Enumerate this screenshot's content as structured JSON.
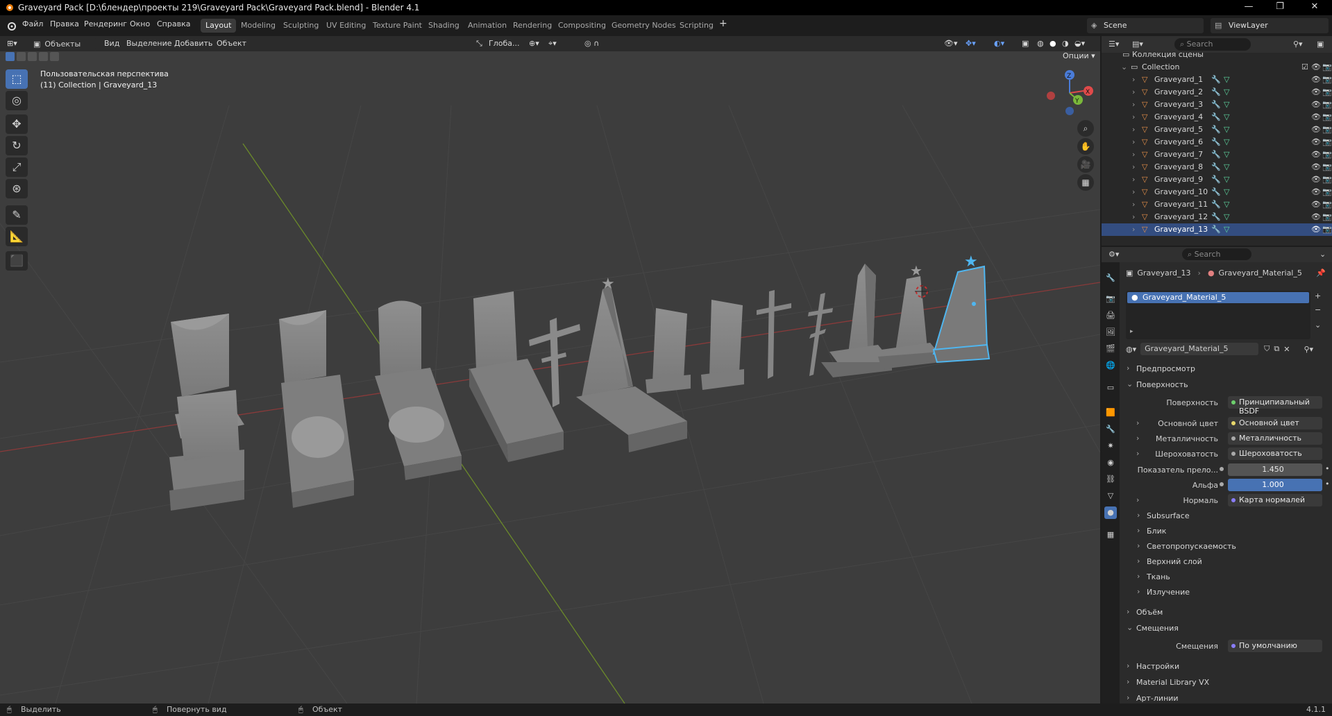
{
  "window": {
    "title": "Graveyard Pack [D:\\блендер\\проекты 219\\Graveyard Pack\\Graveyard Pack.blend] - Blender 4.1"
  },
  "menu": [
    "Файл",
    "Правка",
    "Рендеринг",
    "Окно",
    "Справка"
  ],
  "workspaces": [
    "Layout",
    "Modeling",
    "Sculpting",
    "UV Editing",
    "Texture Paint",
    "Shading",
    "Animation",
    "Rendering",
    "Compositing",
    "Geometry Nodes",
    "Scripting"
  ],
  "active_workspace": "Layout",
  "scene": {
    "scene_name": "Scene",
    "view_layer": "ViewLayer"
  },
  "viewport_header": {
    "mode": "Объекты",
    "menus": [
      "Вид",
      "Выделение",
      "Добавить",
      "Объект"
    ],
    "transform": "Глоба...",
    "options": "Опции"
  },
  "viewport_overlay": {
    "line1": "Пользовательская перспектива",
    "line2": "(11) Collection | Graveyard_13"
  },
  "outliner": {
    "search_placeholder": "Search",
    "scene_collection": "Коллекция сцены",
    "collection": "Collection",
    "items": [
      "Graveyard_1",
      "Graveyard_2",
      "Graveyard_3",
      "Graveyard_4",
      "Graveyard_5",
      "Graveyard_6",
      "Graveyard_7",
      "Graveyard_8",
      "Graveyard_9",
      "Graveyard_10",
      "Graveyard_11",
      "Graveyard_12",
      "Graveyard_13"
    ],
    "selected": "Graveyard_13"
  },
  "properties": {
    "search_placeholder": "Search",
    "breadcrumb_object": "Graveyard_13",
    "breadcrumb_material": "Graveyard_Material_5",
    "slot_material": "Graveyard_Material_5",
    "material_field": "Graveyard_Material_5",
    "sections": {
      "preview": "Предпросмотр",
      "surface": "Поверхность",
      "volume": "Объём",
      "displacement": "Смещения",
      "settings": "Настройки",
      "library": "Material Library VX",
      "lineart": "Арт-линии"
    },
    "surface_rows": [
      {
        "label": "Поверхность",
        "value": "Принципиальный BSDF"
      },
      {
        "label": "Основной цвет",
        "value": "Основной цвет"
      },
      {
        "label": "Металличность",
        "value": "Металличность"
      },
      {
        "label": "Шероховатость",
        "value": "Шероховатость"
      },
      {
        "label": "Показатель прело...",
        "value": "1.450"
      },
      {
        "label": "Альфа",
        "value": "1.000"
      },
      {
        "label": "Нормаль",
        "value": "Карта нормалей"
      }
    ],
    "subpanels": [
      "Subsurface",
      "Блик",
      "Светопропускаемость",
      "Верхний слой",
      "Ткань",
      "Излучение"
    ],
    "displacement_row": {
      "label": "Смещения",
      "value": "По умолчанию"
    }
  },
  "statusbar": {
    "select": "Выделить",
    "rotate": "Повернуть вид",
    "object": "Объект",
    "version": "4.1.1"
  },
  "colors": {
    "accent": "#4772b3",
    "selection_outline": "#4fb6f0",
    "viewport_bg": "#3d3d3d"
  }
}
